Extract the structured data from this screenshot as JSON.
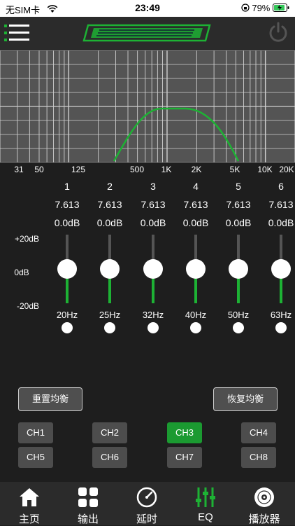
{
  "status_bar": {
    "carrier": "无SIM卡",
    "time": "23:49",
    "battery": "79%"
  },
  "graph": {
    "freq_labels": [
      "31",
      "50",
      "125",
      "500",
      "1K",
      "2K",
      "5K",
      "10K",
      "20K"
    ]
  },
  "scale": {
    "top": "+20dB",
    "mid": "0dB",
    "bottom": "-20dB"
  },
  "bands": [
    {
      "num": "1",
      "q": "7.613",
      "gain": "0.0dB",
      "freq": "20Hz",
      "gain_level": 0.5
    },
    {
      "num": "2",
      "q": "7.613",
      "gain": "0.0dB",
      "freq": "25Hz",
      "gain_level": 0.5
    },
    {
      "num": "3",
      "q": "7.613",
      "gain": "0.0dB",
      "freq": "32Hz",
      "gain_level": 0.5
    },
    {
      "num": "4",
      "q": "7.613",
      "gain": "0.0dB",
      "freq": "40Hz",
      "gain_level": 0.5
    },
    {
      "num": "5",
      "q": "7.613",
      "gain": "0.0dB",
      "freq": "50Hz",
      "gain_level": 0.5
    },
    {
      "num": "6",
      "q": "7.613",
      "gain": "0.0dB",
      "freq": "63Hz",
      "gain_level": 0.5
    }
  ],
  "buttons": {
    "reset_eq": "重置均衡",
    "restore_eq": "恢复均衡"
  },
  "channels": [
    "CH1",
    "CH2",
    "CH3",
    "CH4",
    "CH5",
    "CH6",
    "CH7",
    "CH8"
  ],
  "active_channel": "CH3",
  "nav": [
    {
      "label": "主页",
      "icon": "home-icon"
    },
    {
      "label": "输出",
      "icon": "grid-icon"
    },
    {
      "label": "延时",
      "icon": "gauge-icon"
    },
    {
      "label": "EQ",
      "icon": "equalizer-icon"
    },
    {
      "label": "播放器",
      "icon": "disc-icon"
    }
  ],
  "colors": {
    "accent": "#1db234",
    "active_channel": "#1b9a31",
    "background": "#1e1e1e"
  }
}
